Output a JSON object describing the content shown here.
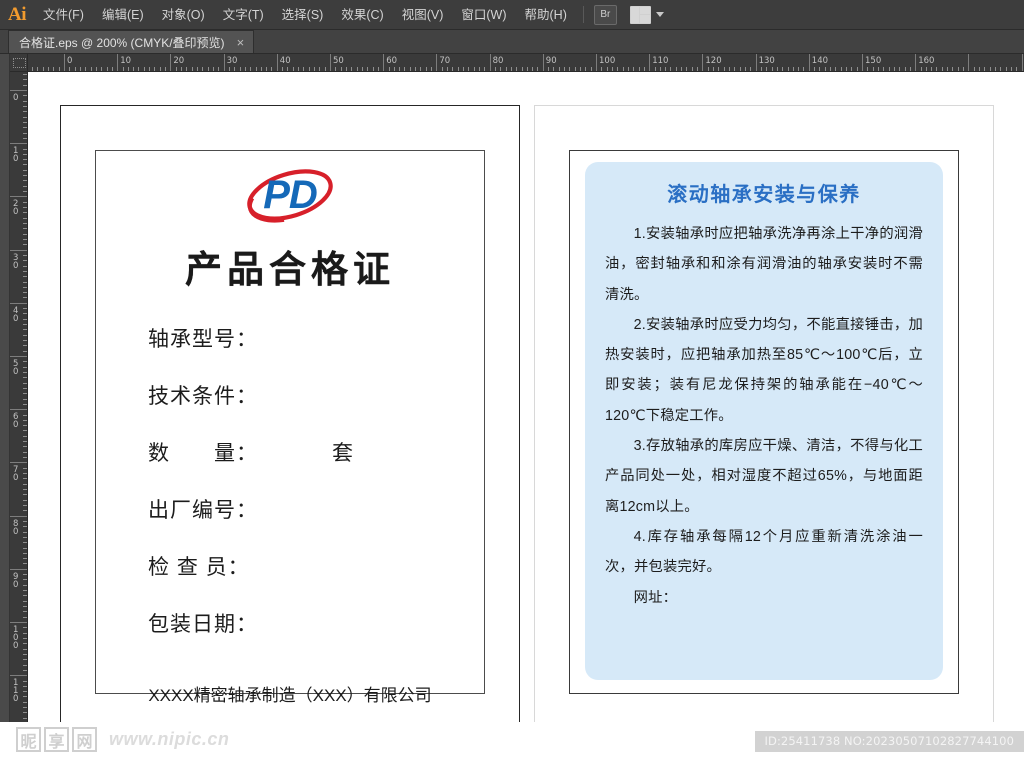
{
  "app": {
    "logo": "Ai",
    "menus": [
      {
        "label": "文件(F)",
        "name": "menu-file"
      },
      {
        "label": "编辑(E)",
        "name": "menu-edit"
      },
      {
        "label": "对象(O)",
        "name": "menu-object"
      },
      {
        "label": "文字(T)",
        "name": "menu-type"
      },
      {
        "label": "选择(S)",
        "name": "menu-select"
      },
      {
        "label": "效果(C)",
        "name": "menu-effect"
      },
      {
        "label": "视图(V)",
        "name": "menu-view"
      },
      {
        "label": "窗口(W)",
        "name": "menu-window"
      },
      {
        "label": "帮助(H)",
        "name": "menu-help"
      }
    ],
    "bridge_button": "Br",
    "arrange_documents_icon": "arrange-documents-icon"
  },
  "tab": {
    "title": "合格证.eps @ 200% (CMYK/叠印预览)",
    "close": "×"
  },
  "rulers": {
    "unit_origin": 0,
    "horizontal_labels": [
      "0",
      "10",
      "20",
      "30",
      "40",
      "50",
      "60",
      "70",
      "80",
      "90",
      "100",
      "110",
      "120",
      "130",
      "140",
      "150",
      "160"
    ],
    "vertical_labels": [
      "0",
      "10",
      "20",
      "30",
      "40",
      "50",
      "60",
      "70",
      "80",
      "90",
      "100",
      "110"
    ]
  },
  "left_page": {
    "logo_text": "PD",
    "title": "产品合格证",
    "fields": [
      {
        "label": "轴承型号：",
        "value": ""
      },
      {
        "label": "技术条件：",
        "value": ""
      },
      {
        "label": "数　　量：",
        "value": "套"
      },
      {
        "label": "出厂编号：",
        "value": ""
      },
      {
        "label": "检 查 员：",
        "value": ""
      },
      {
        "label": "包装日期：",
        "value": ""
      }
    ],
    "company": "XXXX精密轴承制造（XXX）有限公司"
  },
  "right_page": {
    "card_title": "滚动轴承安装与保养",
    "paragraphs": [
      "1.安装轴承时应把轴承洗净再涂上干净的润滑油，密封轴承和和涂有润滑油的轴承安装时不需清洗。",
      "2.安装轴承时应受力均匀，不能直接锤击，加热安装时，应把轴承加热至85℃～100℃后，立即安装；装有尼龙保持架的轴承能在−40℃～120℃下稳定工作。",
      "3.存放轴承的库房应干燥、清洁，不得与化工产品同处一处，相对湿度不超过65%，与地面距离12cm以上。",
      "4.库存轴承每隔12个月应重新清洗涂油一次，并包装完好。",
      "网址："
    ]
  },
  "watermark": {
    "site_chars": [
      "昵",
      "享",
      "网"
    ],
    "url": "www.nipic.cn",
    "id_text": "ID:25411738 NO:20230507102827744100"
  },
  "colors": {
    "accent_orange": "#f29b2e",
    "logo_blue": "#1569b8",
    "logo_red": "#d7202a",
    "card_bg": "#d6e9f8",
    "card_title_blue": "#2a6fc4",
    "chrome_bg": "#3d3d3d"
  }
}
